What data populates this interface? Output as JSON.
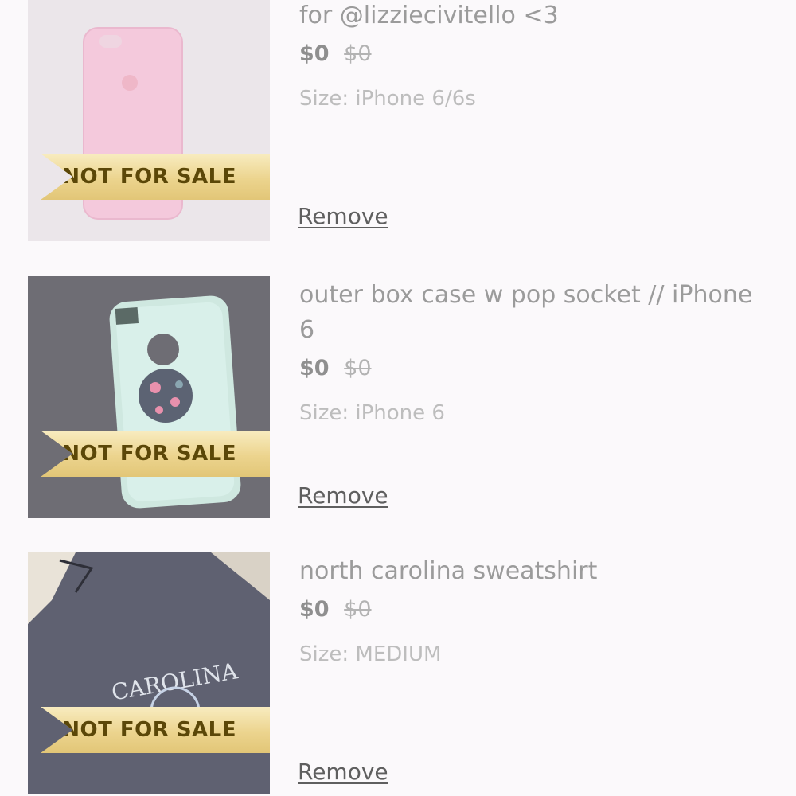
{
  "listings": [
    {
      "title": "for @lizziecivitello <3",
      "price": "$0",
      "original_price": "$0",
      "size": "Size: iPhone 6/6s",
      "badge": "NOT FOR SALE",
      "remove_label": "Remove"
    },
    {
      "title": "outer box case w pop socket // iPhone 6",
      "price": "$0",
      "original_price": "$0",
      "size": "Size: iPhone 6",
      "badge": "NOT FOR SALE",
      "remove_label": "Remove"
    },
    {
      "title": "north carolina sweatshirt",
      "price": "$0",
      "original_price": "$0",
      "size": "Size: MEDIUM",
      "badge": "NOT FOR SALE",
      "remove_label": "Remove",
      "photo_text": "CAROLINA"
    }
  ],
  "colors": {
    "background": "#fbf9fb",
    "badge_gold": "#ecd48e",
    "badge_text": "#5b4708"
  }
}
